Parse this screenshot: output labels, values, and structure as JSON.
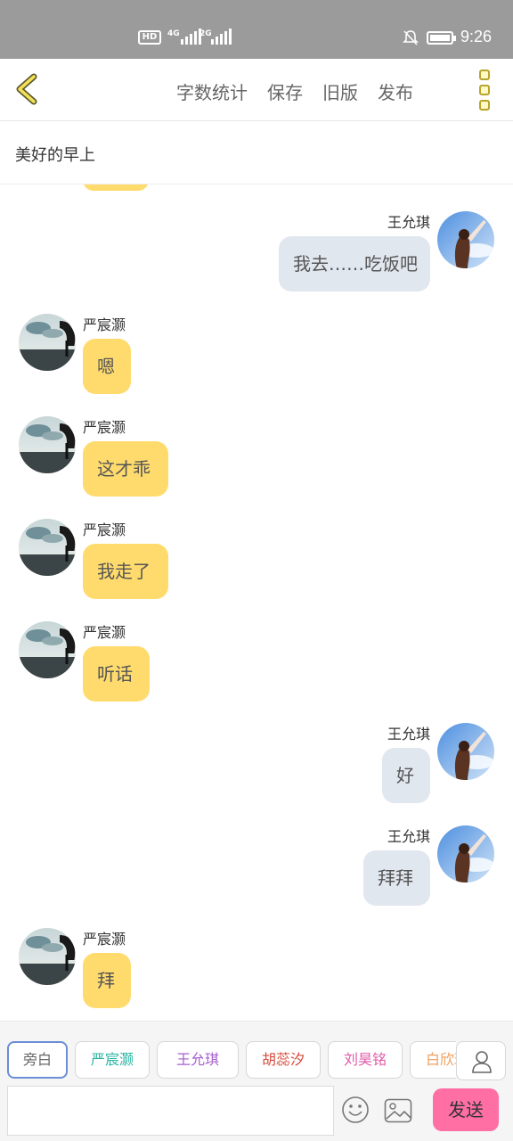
{
  "status_bar": {
    "hd_label": "HD",
    "sim1_label": "4G",
    "sim2_label": "2G",
    "time": "9:26"
  },
  "toolbar": {
    "word_count_label": "字数统计",
    "save_label": "保存",
    "old_version_label": "旧版",
    "publish_label": "发布"
  },
  "story": {
    "title": "美好的早上"
  },
  "messages": [
    {
      "speaker": "王允琪",
      "text": "我去……吃饭吧",
      "side": "right"
    },
    {
      "speaker": "严宸灏",
      "text": "嗯",
      "side": "left"
    },
    {
      "speaker": "严宸灏",
      "text": "这才乖",
      "side": "left"
    },
    {
      "speaker": "严宸灏",
      "text": "我走了",
      "side": "left"
    },
    {
      "speaker": "严宸灏",
      "text": "听话",
      "side": "left"
    },
    {
      "speaker": "王允琪",
      "text": "好",
      "side": "right"
    },
    {
      "speaker": "王允琪",
      "text": "拜拜",
      "side": "right"
    },
    {
      "speaker": "严宸灏",
      "text": "拜",
      "side": "left"
    }
  ],
  "roles": [
    {
      "label": "旁白",
      "color": "#666666",
      "active": true
    },
    {
      "label": "严宸灏",
      "color": "#2bb5a3",
      "active": false
    },
    {
      "label": "王允琪",
      "color": "#a65fcf",
      "active": false
    },
    {
      "label": "胡蕊汐",
      "color": "#d84a3a",
      "active": false
    },
    {
      "label": "刘昊铭",
      "color": "#e05aa8",
      "active": false
    },
    {
      "label": "白欣琪",
      "color": "#f0a060",
      "active": false
    }
  ],
  "composer": {
    "input_value": "",
    "send_label": "发送"
  },
  "colors": {
    "left_bubble": "#ffdb6e",
    "right_bubble": "#e1e7ef",
    "send_button": "#ff6fa3",
    "status_bar": "#9b9b9b"
  }
}
